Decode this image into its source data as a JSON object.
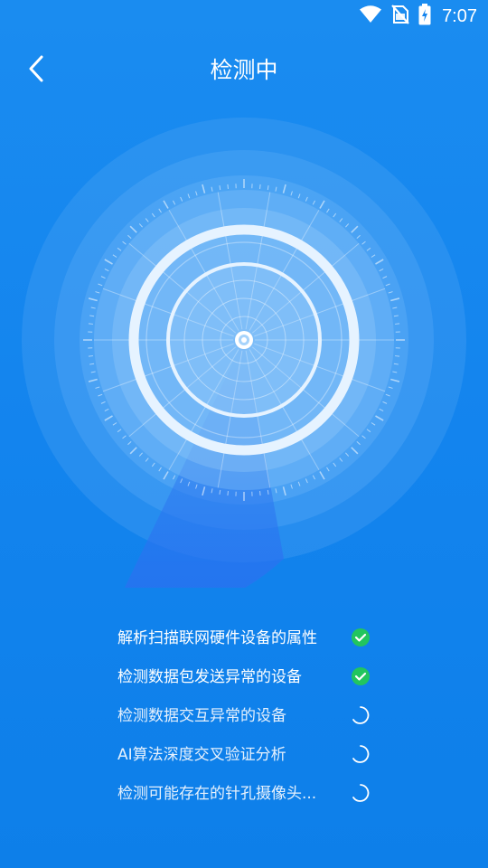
{
  "status_bar": {
    "time": "7:07",
    "icons": [
      "wifi-icon",
      "no-sim-icon",
      "battery-charging-icon"
    ]
  },
  "header": {
    "back_icon": "chevron-left-icon",
    "title": "检测中"
  },
  "colors": {
    "background": "#1384ee",
    "check_done": "#22c55e",
    "text": "#ffffff"
  },
  "checklist": [
    {
      "label": "解析扫描联网硬件设备的属性",
      "status": "done"
    },
    {
      "label": "检测数据包发送异常的设备",
      "status": "done"
    },
    {
      "label": "检测数据交互异常的设备",
      "status": "loading"
    },
    {
      "label": "AI算法深度交叉验证分析",
      "status": "loading"
    },
    {
      "label": "检测可能存在的针孔摄像头...",
      "status": "loading"
    }
  ]
}
